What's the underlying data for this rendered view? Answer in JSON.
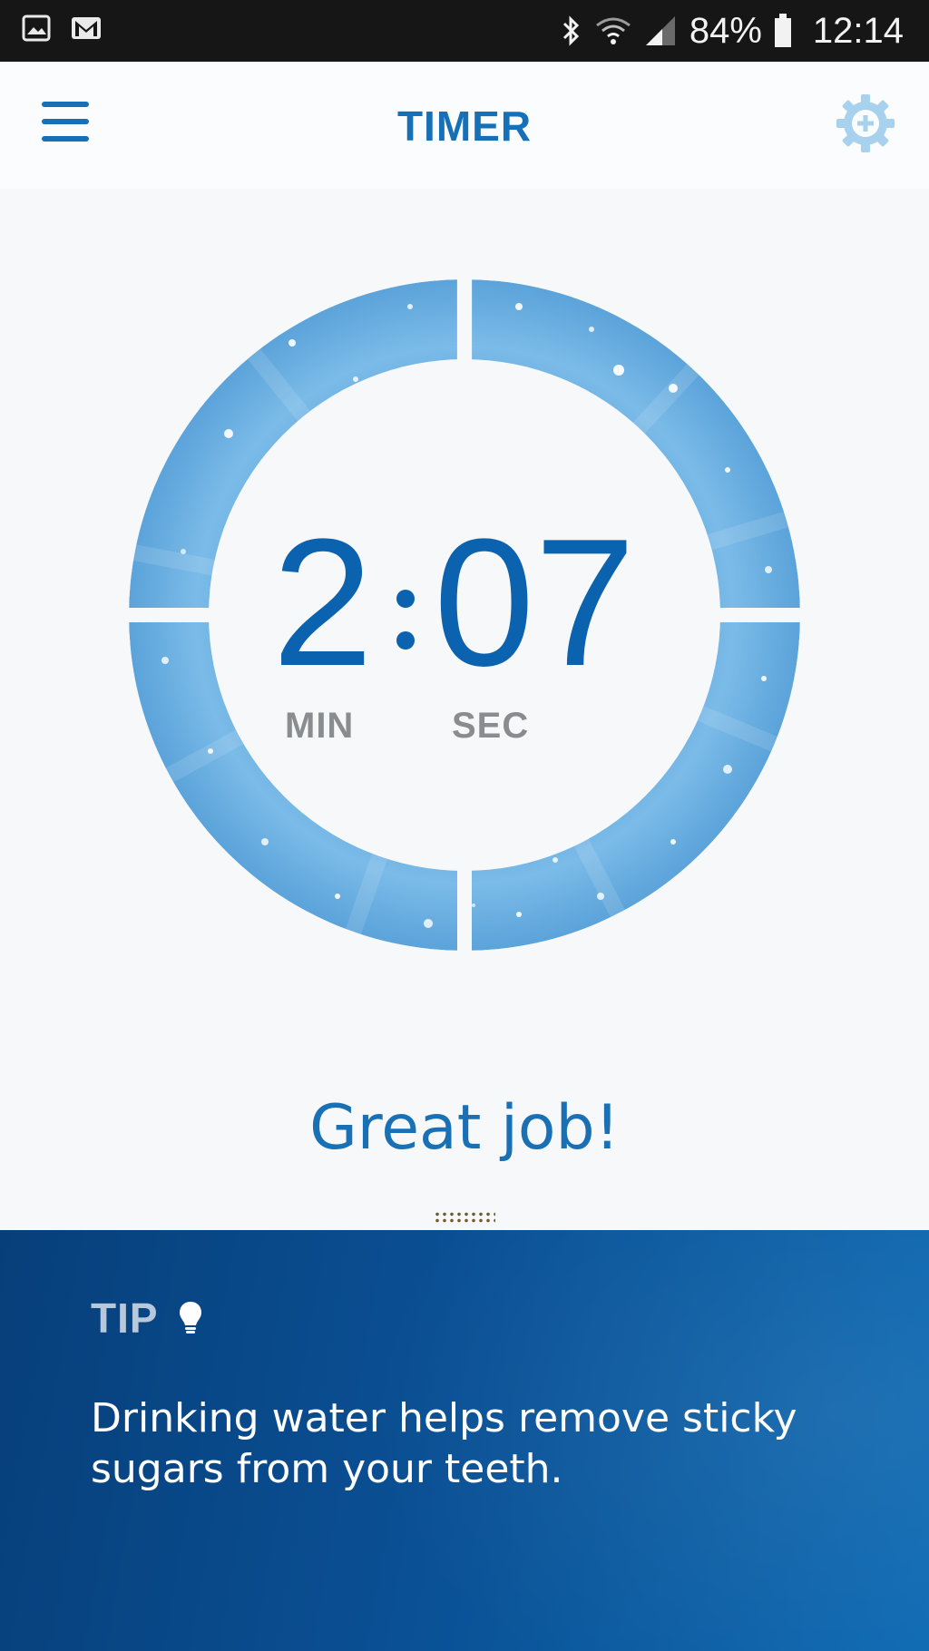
{
  "status_bar": {
    "battery_percent": "84%",
    "time": "12:14",
    "icons": [
      "image-icon",
      "gmail-icon",
      "bluetooth-icon",
      "wifi-icon",
      "signal-icon",
      "battery-icon"
    ]
  },
  "header": {
    "title": "TIMER",
    "menu_icon": "hamburger-menu-icon",
    "settings_icon": "gear-plus-icon"
  },
  "timer": {
    "minutes": "2",
    "seconds": "07",
    "min_label": "MIN",
    "sec_label": "SEC",
    "segments_filled": 4,
    "segments_total": 4
  },
  "message": "Great job!",
  "tip": {
    "label": "TIP",
    "icon": "lightbulb-icon",
    "text": "Drinking water helps remove sticky sugars from your teeth."
  },
  "colors": {
    "primary": "#1670b8",
    "digits": "#0b62ae",
    "ring": "#6fb4e6",
    "tip_bg_start": "#073f7a",
    "tip_bg_end": "#0e6ab3",
    "status_bar": "#161616"
  }
}
